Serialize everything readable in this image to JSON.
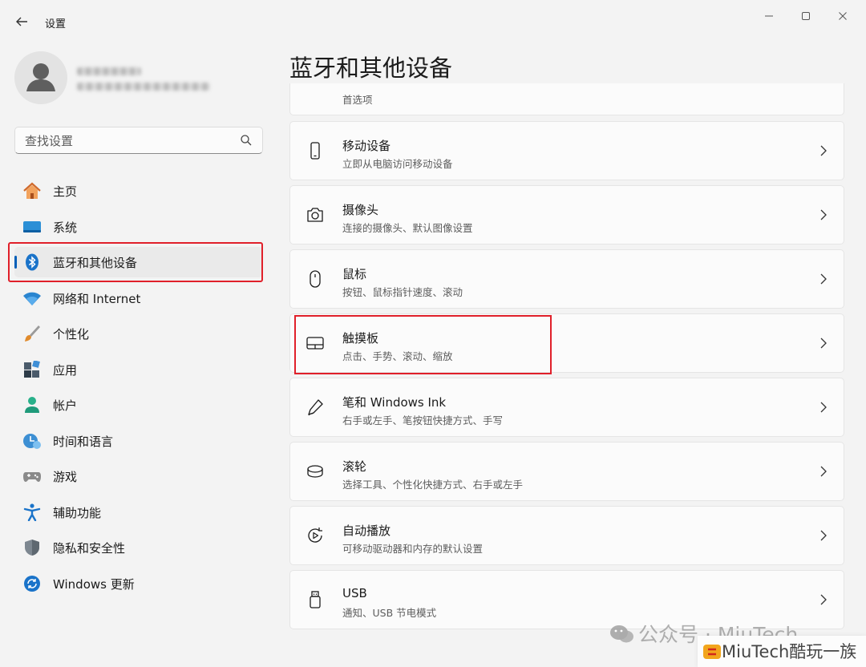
{
  "app": {
    "back_icon": "back-arrow-icon",
    "title": "设置"
  },
  "window_controls": {
    "minimize": "—",
    "maximize": "☐",
    "close": "✕"
  },
  "profile": {
    "name": "████",
    "email": "████████████"
  },
  "search": {
    "placeholder": "查找设置",
    "icon": "search-icon"
  },
  "nav": {
    "items": [
      {
        "label": "主页",
        "icon": "home-icon",
        "selected": false
      },
      {
        "label": "系统",
        "icon": "system-display-icon",
        "selected": false
      },
      {
        "label": "蓝牙和其他设备",
        "icon": "bluetooth-icon",
        "selected": true
      },
      {
        "label": "网络和 Internet",
        "icon": "wifi-icon",
        "selected": false
      },
      {
        "label": "个性化",
        "icon": "paintbrush-icon",
        "selected": false
      },
      {
        "label": "应用",
        "icon": "apps-icon",
        "selected": false
      },
      {
        "label": "帐户",
        "icon": "account-icon",
        "selected": false
      },
      {
        "label": "时间和语言",
        "icon": "time-language-icon",
        "selected": false
      },
      {
        "label": "游戏",
        "icon": "gamepad-icon",
        "selected": false
      },
      {
        "label": "辅助功能",
        "icon": "accessibility-icon",
        "selected": false
      },
      {
        "label": "隐私和安全性",
        "icon": "shield-icon",
        "selected": false
      },
      {
        "label": "Windows 更新",
        "icon": "windows-update-icon",
        "selected": false
      }
    ]
  },
  "main": {
    "title": "蓝牙和其他设备",
    "partial_card": {
      "subtitle": "首选项"
    },
    "cards": [
      {
        "title": "移动设备",
        "subtitle": "立即从电脑访问移动设备",
        "icon": "phone-icon"
      },
      {
        "title": "摄像头",
        "subtitle": "连接的摄像头、默认图像设置",
        "icon": "camera-icon"
      },
      {
        "title": "鼠标",
        "subtitle": "按钮、鼠标指针速度、滚动",
        "icon": "mouse-icon"
      },
      {
        "title": "触摸板",
        "subtitle": "点击、手势、滚动、缩放",
        "icon": "touchpad-icon"
      },
      {
        "title": "笔和 Windows Ink",
        "subtitle": "右手或左手、笔按钮快捷方式、手写",
        "icon": "pen-icon"
      },
      {
        "title": "滚轮",
        "subtitle": "选择工具、个性化快捷方式、右手或左手",
        "icon": "wheel-icon"
      },
      {
        "title": "自动播放",
        "subtitle": "可移动驱动器和内存的默认设置",
        "icon": "autoplay-icon"
      },
      {
        "title": "USB",
        "subtitle": "通知、USB 节电模式",
        "icon": "usb-icon"
      }
    ]
  },
  "annotations": {
    "color": "#e0202a"
  },
  "watermark": {
    "text": "公众号 · MiuTech",
    "bottom_text": "MiuTech酷玩一族"
  },
  "colors": {
    "accent": "#005fb8",
    "background": "#f3f3f3",
    "card": "#fbfbfb"
  }
}
